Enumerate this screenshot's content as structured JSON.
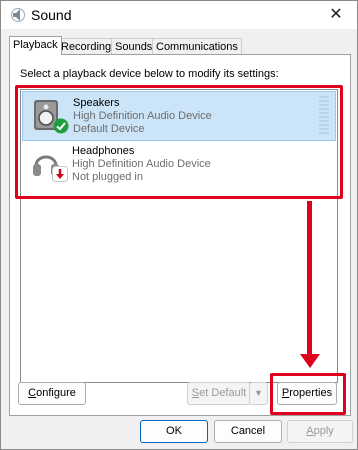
{
  "window": {
    "title": "Sound",
    "close_glyph": "✕"
  },
  "tabs": [
    {
      "label": "Playback",
      "active": true
    },
    {
      "label": "Recording",
      "active": false
    },
    {
      "label": "Sounds",
      "active": false
    },
    {
      "label": "Communications",
      "active": false
    }
  ],
  "instruction": "Select a playback device below to modify its settings:",
  "devices": [
    {
      "name": "Speakers",
      "description": "High Definition Audio Device",
      "status": "Default Device",
      "icon": "speaker-icon",
      "badge": "green-check-badge-icon",
      "selected": true
    },
    {
      "name": "Headphones",
      "description": "High Definition Audio Device",
      "status": "Not plugged in",
      "icon": "headphones-icon",
      "badge": "red-down-arrow-badge-icon",
      "selected": false
    }
  ],
  "buttons": {
    "configure": {
      "key": "C",
      "rest": "onfigure"
    },
    "set_default": {
      "key": "S",
      "rest": "et Default",
      "disabled": true
    },
    "properties": {
      "key": "P",
      "rest": "roperties"
    },
    "ok": "OK",
    "cancel": "Cancel",
    "apply": {
      "key": "A",
      "rest": "pply",
      "disabled": true
    }
  },
  "colors": {
    "selection": "#cce4f7",
    "highlight": "#e0001b",
    "check_badge": "#1e9e3c",
    "unplugged_badge": "#d0021b"
  }
}
